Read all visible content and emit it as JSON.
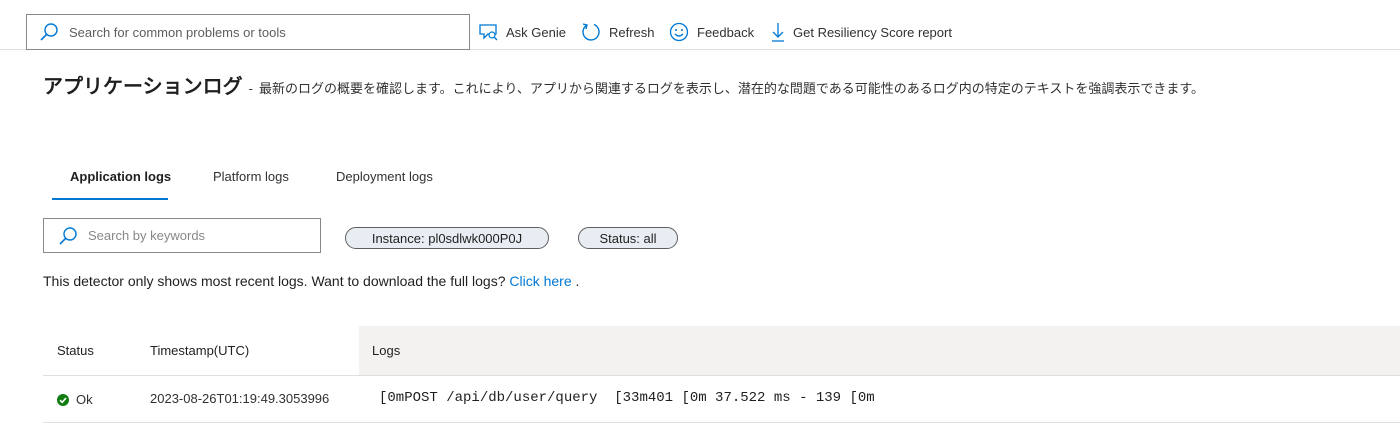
{
  "toolbar": {
    "search_placeholder": "Search for common problems or tools",
    "ask_genie": "Ask Genie",
    "refresh": "Refresh",
    "feedback": "Feedback",
    "resiliency": "Get Resiliency Score report"
  },
  "header": {
    "title": "アプリケーションログ",
    "separator": "-",
    "description": "最新のログの概要を確認します。これにより、アプリから関連するログを表示し、潜在的な問題である可能性のあるログ内の特定のテキストを強調表示できます。"
  },
  "tabs": [
    {
      "label": "Application logs",
      "active": true
    },
    {
      "label": "Platform logs",
      "active": false
    },
    {
      "label": "Deployment logs",
      "active": false
    }
  ],
  "filters": {
    "keyword_placeholder": "Search by keywords",
    "instance": "Instance: pl0sdlwk000P0J",
    "status": "Status: all"
  },
  "info": {
    "text": "This detector only shows most recent logs. Want to download the full logs? ",
    "link": "Click here",
    "suffix": " ."
  },
  "table": {
    "columns": [
      "Status",
      "Timestamp(UTC)",
      "Logs"
    ],
    "rows": [
      {
        "status": "Ok",
        "timestamp": "2023-08-26T01:19:49.3053996",
        "log": "[0mPOST /api/db/user/query  [33m401 [0m 37.522 ms - 139 [0m"
      }
    ]
  },
  "colors": {
    "accent": "#0078d4",
    "ok": "#107c10",
    "header_bg": "#f3f2f1"
  }
}
